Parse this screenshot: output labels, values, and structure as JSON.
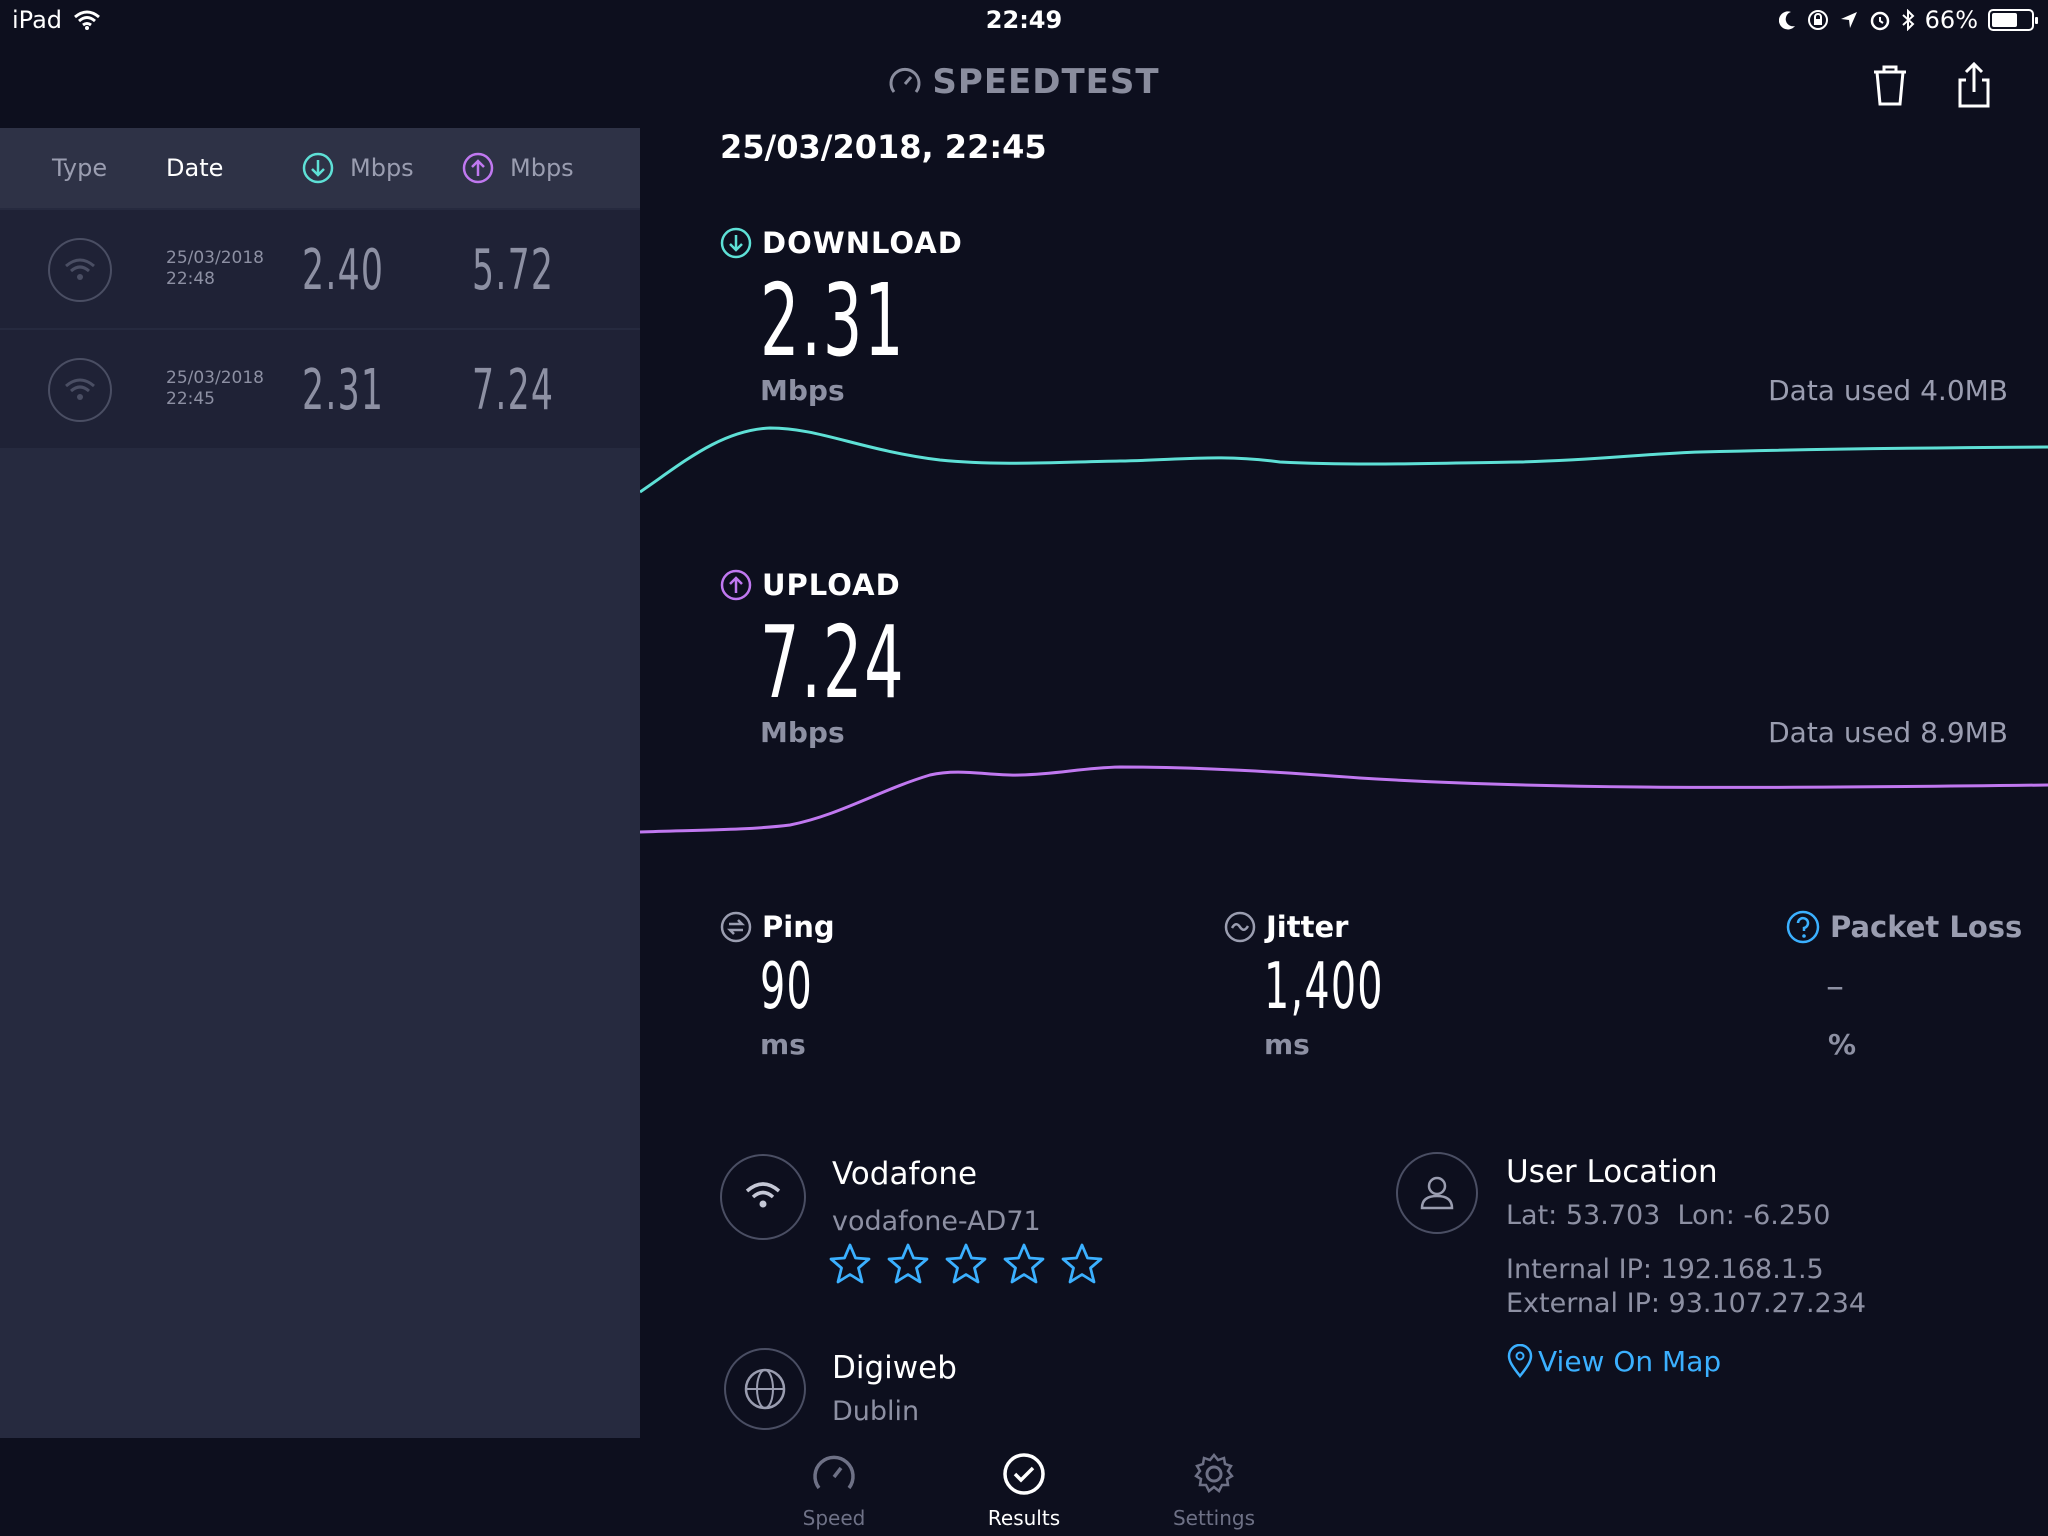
{
  "status_bar": {
    "device": "iPad",
    "time": "22:49",
    "battery": "66%",
    "battery_level": 0.66
  },
  "header": {
    "brand": "SPEEDTEST",
    "delete_icon": "trash-icon",
    "share_icon": "share-icon"
  },
  "history": {
    "columns": {
      "type": "Type",
      "date": "Date",
      "download_unit": "Mbps",
      "upload_unit": "Mbps"
    },
    "rows": [
      {
        "date": "25/03/2018",
        "time": "22:48",
        "download": "2.40",
        "upload": "5.72"
      },
      {
        "date": "25/03/2018",
        "time": "22:45",
        "download": "2.31",
        "upload": "7.24"
      }
    ]
  },
  "result": {
    "datetime": "25/03/2018, 22:45",
    "download": {
      "label": "DOWNLOAD",
      "value": "2.31",
      "unit": "Mbps",
      "data_used": "Data used 4.0MB"
    },
    "upload": {
      "label": "UPLOAD",
      "value": "7.24",
      "unit": "Mbps",
      "data_used": "Data used 8.9MB"
    },
    "ping": {
      "label": "Ping",
      "value": "90",
      "unit": "ms"
    },
    "jitter": {
      "label": "Jitter",
      "value": "1,400",
      "unit": "ms"
    },
    "packet_loss": {
      "label": "Packet Loss",
      "value": "–",
      "unit": "%"
    }
  },
  "connection": {
    "isp": "Vodafone",
    "network": "vodafone-AD71",
    "rating_max": 5,
    "server_name": "Digiweb",
    "server_city": "Dublin"
  },
  "location": {
    "title": "User Location",
    "coords": "Lat: 53.703  Lon: -6.250",
    "internal_ip": "Internal IP: 192.168.1.5",
    "external_ip": "External IP: 93.107.27.234",
    "map_link": "View On Map"
  },
  "tabs": [
    {
      "label": "Speed",
      "icon": "speedometer-icon"
    },
    {
      "label": "Results",
      "icon": "check-circle-icon"
    },
    {
      "label": "Settings",
      "icon": "gear-icon"
    }
  ],
  "colors": {
    "background": "#0d0f1e",
    "download": "#5ee0d6",
    "upload": "#c078f0",
    "link": "#3bb0ff"
  }
}
